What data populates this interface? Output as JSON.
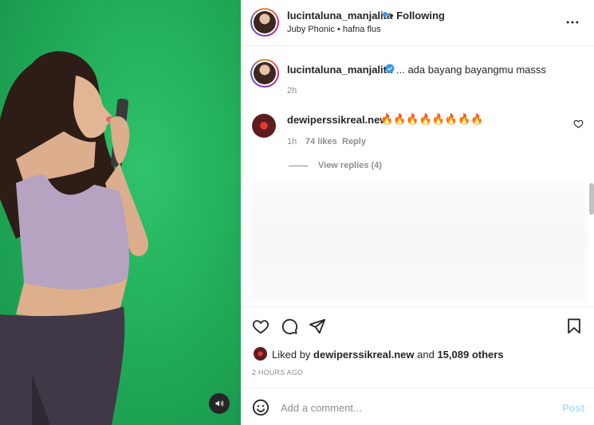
{
  "post": {
    "username": "lucintaluna_manjalita",
    "separator": "•",
    "following_label": "Following",
    "audio_label": "Juby Phonic • hafna flus",
    "more_icon": "more-horizontal-icon",
    "audio_icon": "speaker-icon"
  },
  "caption": {
    "username": "lucintaluna_manjalita",
    "text": "... ada bayang bayangmu masss",
    "time": "2h",
    "verified_icon": "verified-badge-icon"
  },
  "comments": [
    {
      "username": "dewiperssikreal.new",
      "text": "🔥🔥🔥🔥🔥🔥🔥🔥",
      "time": "1h",
      "likes": "74 likes",
      "reply_label": "Reply",
      "view_replies": "View replies (4)"
    }
  ],
  "actions": {
    "like_icon": "heart-icon",
    "comment_icon": "comment-icon",
    "share_icon": "share-icon",
    "save_icon": "bookmark-icon",
    "liked_by_prefix": "Liked by",
    "liked_by_user": "dewiperssikreal.new",
    "liked_by_mid": "and",
    "liked_by_count": "15,089 others",
    "posted_time": "2 HOURS AGO"
  },
  "composer": {
    "placeholder": "Add a comment...",
    "post_label": "Post",
    "emoji_icon": "emoji-icon"
  },
  "colors": {
    "verified": "#3897f0",
    "muted": "#8e8e8e",
    "post_disabled": "#b3dbff",
    "green_screen": "#20a957"
  }
}
